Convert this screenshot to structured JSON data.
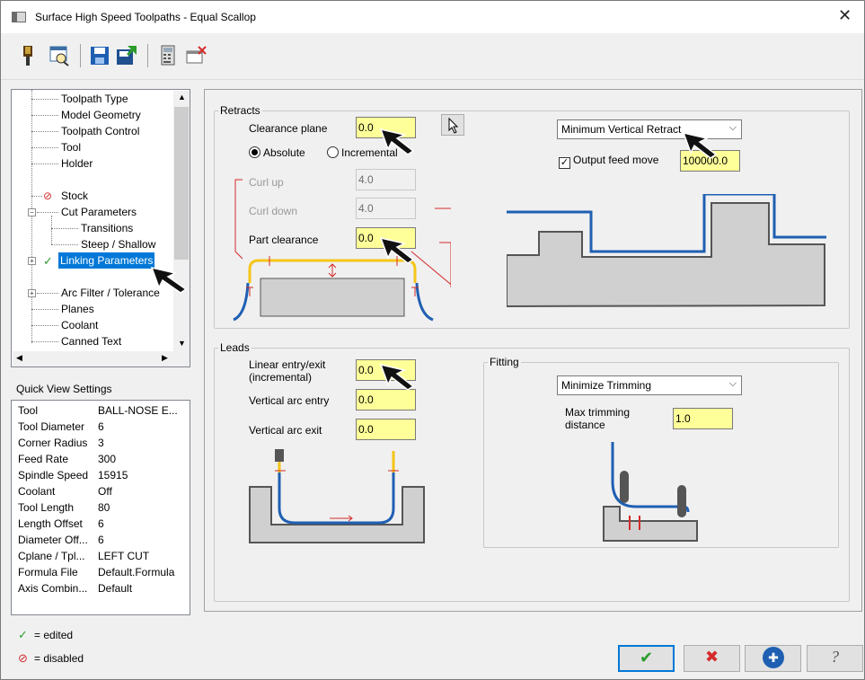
{
  "window": {
    "title": "Surface High Speed Toolpaths - Equal Scallop",
    "close_glyph": "✕"
  },
  "toolbar": {
    "icons": [
      "tool-icon",
      "preview-icon",
      "save-icon",
      "import-icon",
      "calculator-icon",
      "close-window-icon"
    ]
  },
  "tree": {
    "items": [
      {
        "label": "Toolpath Type"
      },
      {
        "label": "Model Geometry"
      },
      {
        "label": "Toolpath Control"
      },
      {
        "label": "Tool"
      },
      {
        "label": "Holder"
      },
      {
        "label": "Stock"
      },
      {
        "label": "Cut Parameters"
      },
      {
        "label": "Transitions"
      },
      {
        "label": "Steep / Shallow"
      },
      {
        "label": "Linking Parameters"
      },
      {
        "label": "Arc Filter / Tolerance"
      },
      {
        "label": "Planes"
      },
      {
        "label": "Coolant"
      },
      {
        "label": "Canned Text"
      }
    ]
  },
  "quick_view": {
    "title": "Quick View Settings",
    "rows": [
      {
        "k": "Tool",
        "v": "BALL-NOSE E..."
      },
      {
        "k": "Tool Diameter",
        "v": "6"
      },
      {
        "k": "Corner Radius",
        "v": "3"
      },
      {
        "k": "Feed Rate",
        "v": "300"
      },
      {
        "k": "Spindle Speed",
        "v": "15915"
      },
      {
        "k": "Coolant",
        "v": "Off"
      },
      {
        "k": "Tool Length",
        "v": "80"
      },
      {
        "k": "Length Offset",
        "v": "6"
      },
      {
        "k": "Diameter Off...",
        "v": "6"
      },
      {
        "k": "Cplane / Tpl...",
        "v": "LEFT CUT"
      },
      {
        "k": "Formula File",
        "v": "Default.Formula"
      },
      {
        "k": "Axis Combin...",
        "v": "Default"
      }
    ]
  },
  "legend": {
    "edited": "= edited",
    "disabled": "= disabled"
  },
  "retracts": {
    "title": "Retracts",
    "clearance_plane_label": "Clearance plane",
    "clearance_plane_value": "0.0",
    "absolute_label": "Absolute",
    "incremental_label": "Incremental",
    "curl_up_label": "Curl up",
    "curl_up_value": "4.0",
    "curl_down_label": "Curl down",
    "curl_down_value": "4.0",
    "part_clearance_label": "Part clearance",
    "part_clearance_value": "0.0",
    "retract_mode": "Minimum Vertical Retract",
    "output_feed_label": "Output feed move",
    "output_feed_value": "100000.0"
  },
  "leads": {
    "title": "Leads",
    "linear_label_1": "Linear entry/exit",
    "linear_label_2": "(incremental)",
    "linear_value": "0.0",
    "arc_entry_label": "Vertical arc entry",
    "arc_entry_value": "0.0",
    "arc_exit_label": "Vertical arc exit",
    "arc_exit_value": "0.0"
  },
  "fitting": {
    "title": "Fitting",
    "mode": "Minimize Trimming",
    "max_label_1": "Max trimming",
    "max_label_2": "distance",
    "max_value": "1.0"
  },
  "buttons": {
    "ok": "✔",
    "cancel": "✖",
    "add": "✚",
    "help": "?"
  },
  "colors": {
    "input_yellow": "#ffff99",
    "selection_blue": "#0078d7",
    "edited_green": "#2a9d2a",
    "disabled_red": "#d42a2a"
  }
}
